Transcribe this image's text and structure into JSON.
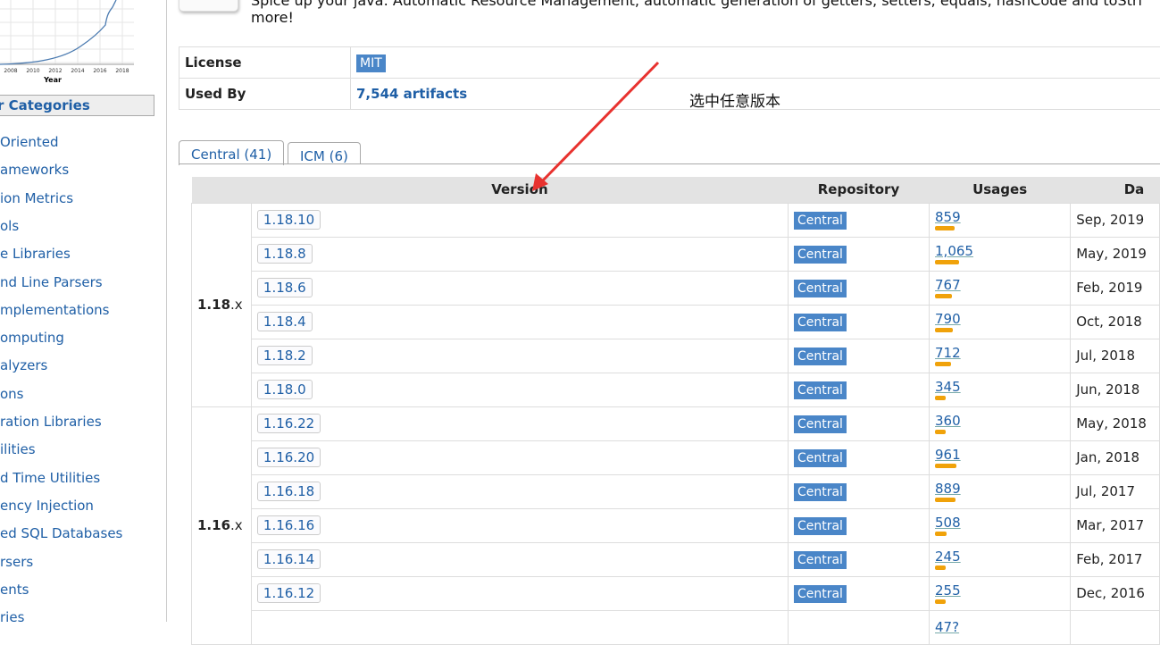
{
  "sidebar": {
    "chart": {
      "xlabel": "Year",
      "ticks": [
        "2008",
        "2010",
        "2012",
        "2014",
        "2016",
        "2018"
      ]
    },
    "categories_title": "r Categories",
    "categories": [
      "Oriented",
      "ameworks",
      "ion Metrics",
      "ols",
      "e Libraries",
      "nd Line Parsers",
      "mplementations",
      "omputing",
      "alyzers",
      "ons",
      "ration Libraries",
      "ilities",
      "d Time Utilities",
      "ency Injection",
      "ed SQL Databases",
      "rsers",
      "ents",
      "ries"
    ]
  },
  "header": {
    "description_line1": "Spice up your java: Automatic Resource Management, automatic generation of getters, setters, equals, hashCode and toStri",
    "description_line2": "more!"
  },
  "info": {
    "license_label": "License",
    "license_value": "MIT",
    "used_by_label": "Used By",
    "used_by_value": "7,544 artifacts"
  },
  "annotation": {
    "text": "选中任意版本",
    "color": "#e8322f"
  },
  "tabs": [
    {
      "label": "Central (41)",
      "active": true
    },
    {
      "label": "ICM (6)",
      "active": false
    }
  ],
  "table": {
    "headers": [
      "Version",
      "Repository",
      "Usages",
      "Da"
    ],
    "groups": [
      {
        "major": "1.18",
        "suffix": ".x",
        "rows": [
          {
            "version": "1.18.10",
            "repo": "Central",
            "usages": "859",
            "date": "Sep, 2019"
          },
          {
            "version": "1.18.8",
            "repo": "Central",
            "usages": "1,065",
            "date": "May, 2019"
          },
          {
            "version": "1.18.6",
            "repo": "Central",
            "usages": "767",
            "date": "Feb, 2019"
          },
          {
            "version": "1.18.4",
            "repo": "Central",
            "usages": "790",
            "date": "Oct, 2018"
          },
          {
            "version": "1.18.2",
            "repo": "Central",
            "usages": "712",
            "date": "Jul, 2018"
          },
          {
            "version": "1.18.0",
            "repo": "Central",
            "usages": "345",
            "date": "Jun, 2018"
          }
        ]
      },
      {
        "major": "1.16",
        "suffix": ".x",
        "rows": [
          {
            "version": "1.16.22",
            "repo": "Central",
            "usages": "360",
            "date": "May, 2018"
          },
          {
            "version": "1.16.20",
            "repo": "Central",
            "usages": "961",
            "date": "Jan, 2018"
          },
          {
            "version": "1.16.18",
            "repo": "Central",
            "usages": "889",
            "date": "Jul, 2017"
          },
          {
            "version": "1.16.16",
            "repo": "Central",
            "usages": "508",
            "date": "Mar, 2017"
          },
          {
            "version": "1.16.14",
            "repo": "Central",
            "usages": "245",
            "date": "Feb, 2017"
          },
          {
            "version": "1.16.12",
            "repo": "Central",
            "usages": "255",
            "date": "Dec, 2016"
          },
          {
            "version": "",
            "repo": "",
            "usages": "47?",
            "date": ""
          }
        ]
      }
    ]
  },
  "colors": {
    "link": "#1f5fa6",
    "badge": "#4a86c8",
    "usage_bar": "#f0a20a"
  }
}
